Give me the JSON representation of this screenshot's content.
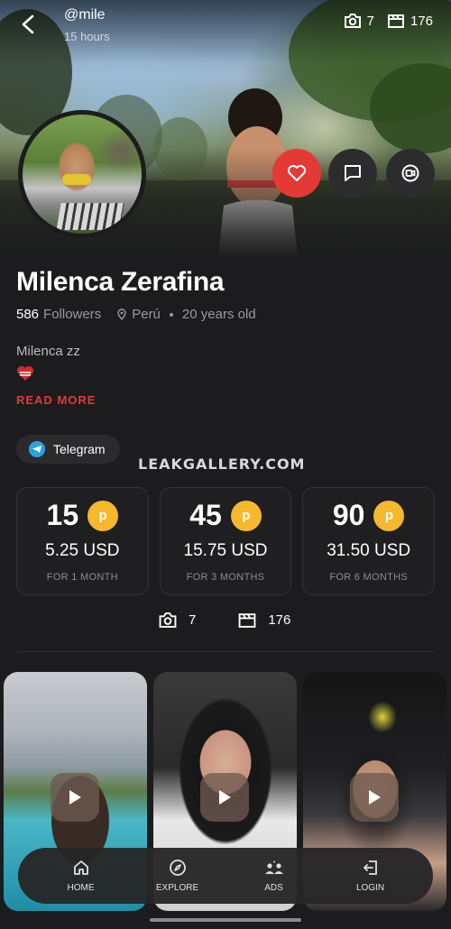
{
  "header": {
    "handle": "@mile",
    "since": "15 hours",
    "photo_count": "7",
    "video_count": "176"
  },
  "profile": {
    "name": "Milenca Zerafina",
    "followers_count": "586",
    "followers_label": "Followers",
    "location": "Perú",
    "age": "20 years old",
    "bio": "Milenca zz",
    "read_more": "READ MORE",
    "telegram_label": "Telegram"
  },
  "watermark": "LEAKGALLERY.COM",
  "plans": [
    {
      "price": "15",
      "coin": "p",
      "usd": "5.25 USD",
      "period": "FOR 1 MONTH"
    },
    {
      "price": "45",
      "coin": "p",
      "usd": "15.75 USD",
      "period": "FOR 3 MONTHS"
    },
    {
      "price": "90",
      "coin": "p",
      "usd": "31.50 USD",
      "period": "FOR 6 MONTHS"
    }
  ],
  "media": {
    "photos": "7",
    "videos": "176"
  },
  "nav": {
    "home": "HOME",
    "explore": "EXPLORE",
    "ads": "ADS",
    "login": "LOGIN"
  },
  "colors": {
    "accent_red": "#e53935",
    "coin_gold": "#f5b82e",
    "telegram_blue": "#2aa3e0",
    "background": "#1c1c1e"
  }
}
